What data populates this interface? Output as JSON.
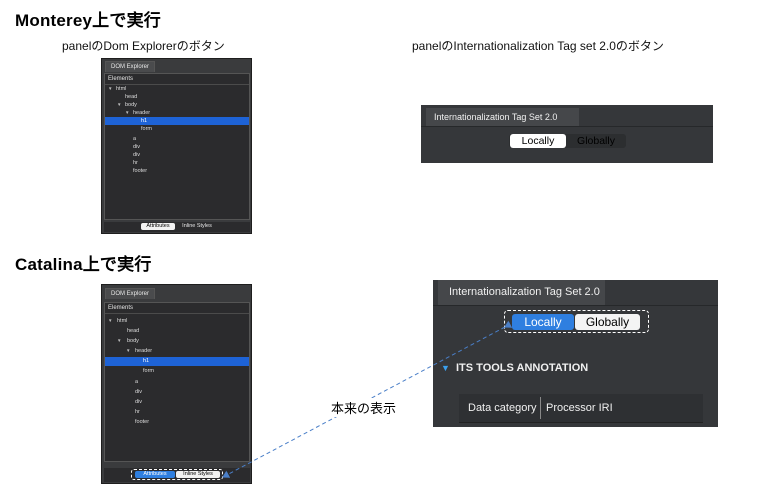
{
  "headings": {
    "monterey": "Monterey上で実行",
    "catalina": "Catalina上で実行"
  },
  "captions": {
    "dom_panel": "panelのDom Explorerのボタン",
    "its_panel": "panelのInternationalization Tag set 2.0のボタン",
    "annotation": "本来の表示"
  },
  "monterey_dom": {
    "tab": "DOM Explorer",
    "tree_header": "Elements",
    "nodes": [
      "html",
      "head",
      "body",
      "header",
      "h1",
      "form",
      "a",
      "div",
      "div",
      "hr",
      "footer"
    ],
    "buttons": [
      "Attributes",
      "Inline Styles"
    ]
  },
  "catalina_dom": {
    "tab": "DOM Explorer",
    "tree_header": "Elements",
    "nodes": [
      "html",
      "head",
      "body",
      "header",
      "h1",
      "form",
      "a",
      "div",
      "div",
      "hr",
      "footer"
    ],
    "buttons": [
      "Attributes",
      "Inline Styles"
    ]
  },
  "monterey_its": {
    "tab": "Internationalization Tag Set 2.0",
    "buttons": [
      "Locally",
      "Globally"
    ]
  },
  "catalina_its": {
    "tab": "Internationalization Tag Set 2.0",
    "buttons": [
      "Locally",
      "Globally"
    ],
    "section": "ITS TOOLS ANNOTATION",
    "columns": [
      "Data category",
      "Processor IRI"
    ]
  },
  "colors": {
    "panel_bg": "#3a3b3d",
    "tree_bg": "#2b2b2d",
    "selection": "#1e63d6",
    "accent_blue": "#2f7fe0",
    "arrow": "#4a7fc8"
  }
}
